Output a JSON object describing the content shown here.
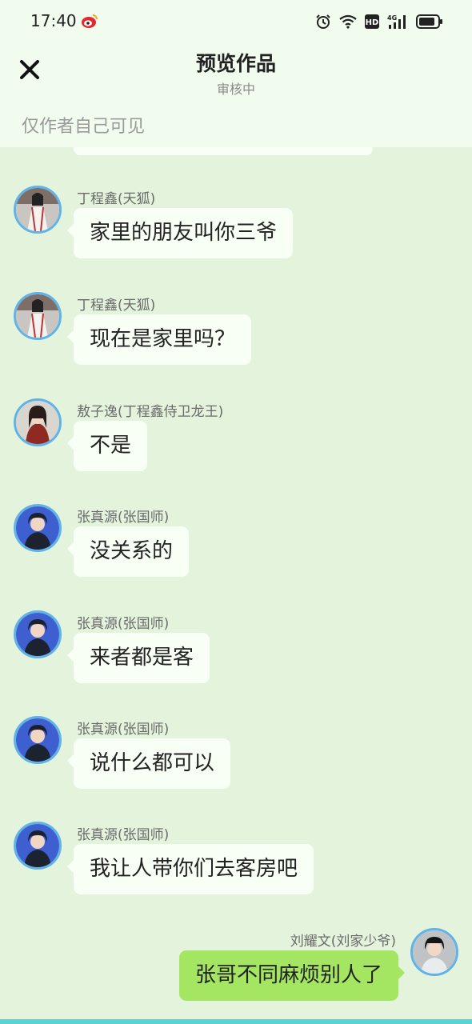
{
  "status_bar": {
    "time": "17:40",
    "icons": [
      "weibo-icon",
      "alarm-icon",
      "wifi-icon",
      "hd-icon",
      "signal-4g-icon",
      "battery-icon"
    ],
    "hd_label": "HD",
    "network_label": "4G"
  },
  "header": {
    "close_icon": "close-icon",
    "title": "预览作品",
    "subtitle": "审核中",
    "visibility_note": "仅作者自己可见"
  },
  "messages": [
    {
      "side": "left",
      "name": "丁程鑫(天狐)",
      "text": "家里的朋友叫你三爷",
      "avatar": "avatar-white-robe"
    },
    {
      "side": "left",
      "name": "丁程鑫(天狐)",
      "text": "现在是家里吗？",
      "avatar": "avatar-white-robe"
    },
    {
      "side": "left",
      "name": "敖子逸(丁程鑫侍卫龙王)",
      "text": "不是",
      "avatar": "avatar-red-robe"
    },
    {
      "side": "left",
      "name": "张真源(张国师)",
      "text": "没关系的",
      "avatar": "avatar-dark-shirt"
    },
    {
      "side": "left",
      "name": "张真源(张国师)",
      "text": "来者都是客",
      "avatar": "avatar-dark-shirt"
    },
    {
      "side": "left",
      "name": "张真源(张国师)",
      "text": "说什么都可以",
      "avatar": "avatar-dark-shirt"
    },
    {
      "side": "left",
      "name": "张真源(张国师)",
      "text": "我让人带你们去客房吧",
      "avatar": "avatar-dark-shirt"
    },
    {
      "side": "right",
      "name": "刘耀文(刘家少爷)",
      "text": "张哥不同麻烦别人了",
      "avatar": "avatar-black-hair"
    }
  ],
  "colors": {
    "background": "#e3f3dc",
    "header_background": "#f1fcef",
    "incoming_bubble": "#f8fff5",
    "outgoing_bubble": "#a4e661",
    "avatar_ring": "#5fb3e8"
  }
}
